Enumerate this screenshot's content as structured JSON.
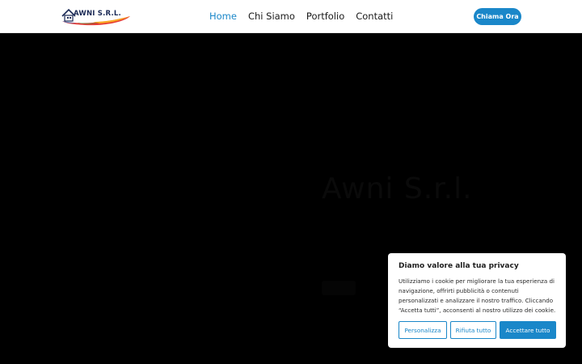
{
  "header": {
    "logo_text": "AWNI S.R.L.",
    "nav": [
      {
        "label": "Home",
        "active": true
      },
      {
        "label": "Chi Siamo",
        "active": false
      },
      {
        "label": "Portfolio",
        "active": false
      },
      {
        "label": "Contatti",
        "active": false
      }
    ],
    "cta_label": "Chiama Ora"
  },
  "hero": {
    "title": "Awni S.r.l."
  },
  "cookie_banner": {
    "title": "Diamo valore alla tua privacy",
    "text": "Utilizziamo i cookie per migliorare la tua esperienza di navigazione, offrirti pubblicità o contenuti personalizzati e analizzare il nostro traffico. Cliccando “Accetta tutti”, acconsenti al nostro utilizzo dei cookie.",
    "buttons": {
      "customize": "Personalizza",
      "reject": "Rifiuta tutto",
      "accept": "Accettare tutto"
    }
  },
  "colors": {
    "accent": "#1a87c9",
    "header_bg": "#ffffff",
    "hero_bg": "#000000"
  },
  "icons": [
    "house-logo-icon",
    "paint-swoosh-icon"
  ]
}
